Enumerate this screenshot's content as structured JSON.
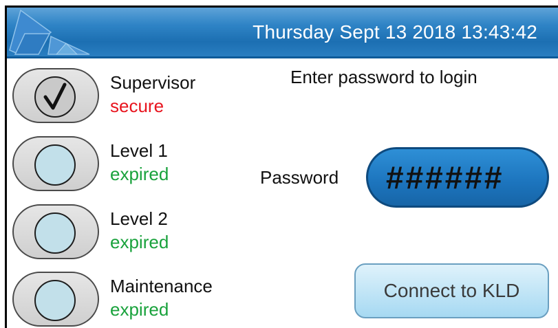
{
  "header": {
    "datetime": "Thursday Sept 13 2018 13:43:42"
  },
  "levels": [
    {
      "name": "Supervisor",
      "status": "secure",
      "status_color": "#e8141e",
      "checked": true
    },
    {
      "name": "Level 1",
      "status": "expired",
      "status_color": "#19a23c",
      "checked": false
    },
    {
      "name": "Level 2",
      "status": "expired",
      "status_color": "#19a23c",
      "checked": false
    },
    {
      "name": "Maintenance",
      "status": "expired",
      "status_color": "#19a23c",
      "checked": false
    }
  ],
  "login": {
    "prompt": "Enter password to login",
    "password_label": "Password",
    "password_value": "######"
  },
  "connect_button": "Connect to KLD",
  "colors": {
    "header": "#2f84c6",
    "secure": "#e8141e",
    "expired": "#19a23c",
    "password_field": "#1c74bd"
  }
}
